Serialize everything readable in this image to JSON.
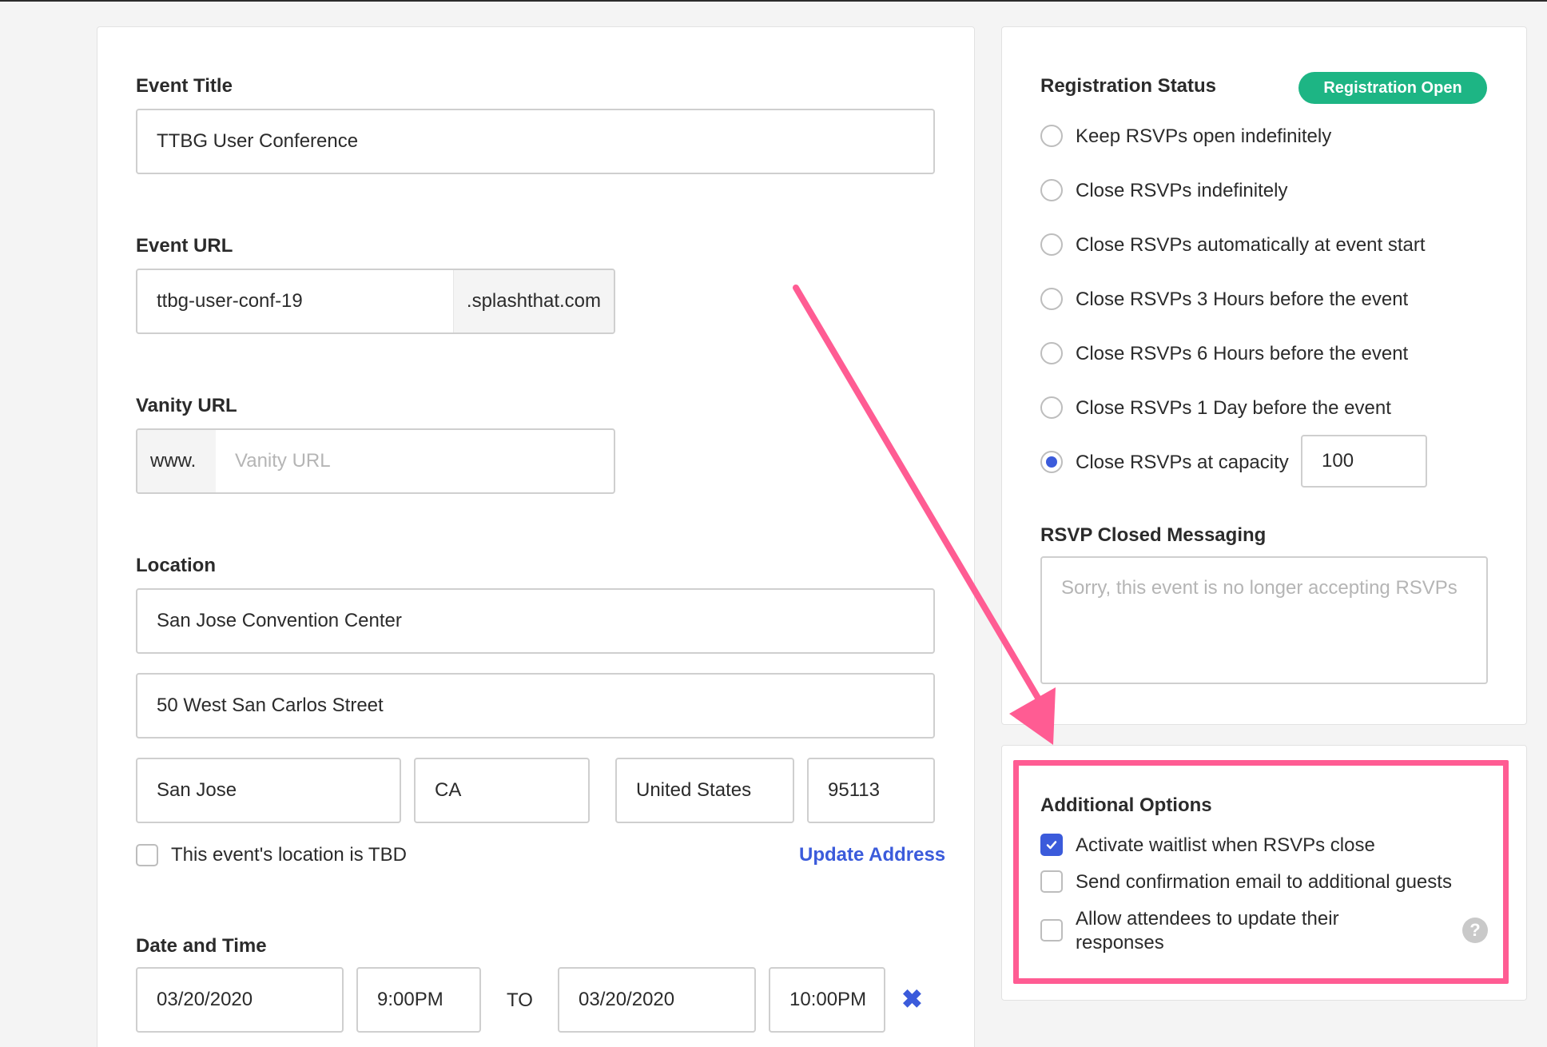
{
  "event_details": {
    "title_label": "Event Title",
    "title_value": "TTBG User Conference",
    "url_label": "Event URL",
    "url_value": "ttbg-user-conf-19",
    "url_suffix": ".splashthat.com",
    "vanity_label": "Vanity URL",
    "vanity_prefix": "www.",
    "vanity_placeholder": "Vanity URL",
    "location_label": "Location",
    "venue": "San Jose Convention Center",
    "street": "50 West San Carlos Street",
    "city": "San Jose",
    "state": "CA",
    "country": "United States",
    "zip": "95113",
    "tbd_label": "This event's location is TBD",
    "update_address": "Update Address",
    "datetime_label": "Date and Time",
    "start_date": "03/20/2020",
    "start_time": "9:00PM",
    "to_label": "TO",
    "end_date": "03/20/2020",
    "end_time": "10:00PM"
  },
  "registration": {
    "status_label": "Registration Status",
    "status_badge": "Registration Open",
    "options": [
      {
        "label": "Keep RSVPs open indefinitely",
        "selected": false
      },
      {
        "label": "Close RSVPs indefinitely",
        "selected": false
      },
      {
        "label": "Close RSVPs automatically at event start",
        "selected": false
      },
      {
        "label": "Close RSVPs 3 Hours before the event",
        "selected": false
      },
      {
        "label": "Close RSVPs 6 Hours before the event",
        "selected": false
      },
      {
        "label": "Close RSVPs 1 Day before the event",
        "selected": false
      },
      {
        "label": "Close RSVPs at capacity",
        "selected": true
      }
    ],
    "capacity_value": "100",
    "closed_messaging_label": "RSVP Closed Messaging",
    "closed_messaging_placeholder": "Sorry, this event is no longer accepting RSVPs"
  },
  "additional_options": {
    "title": "Additional Options",
    "items": [
      {
        "label": "Activate waitlist when RSVPs close",
        "checked": true
      },
      {
        "label": "Send confirmation email to additional guests",
        "checked": false
      },
      {
        "label": "Allow attendees to update their",
        "label_line2": "responses",
        "checked": false
      }
    ]
  },
  "colors": {
    "accent": "#3b5bdb",
    "badge_green": "#1db584",
    "annotation_pink": "#ff5c93"
  }
}
